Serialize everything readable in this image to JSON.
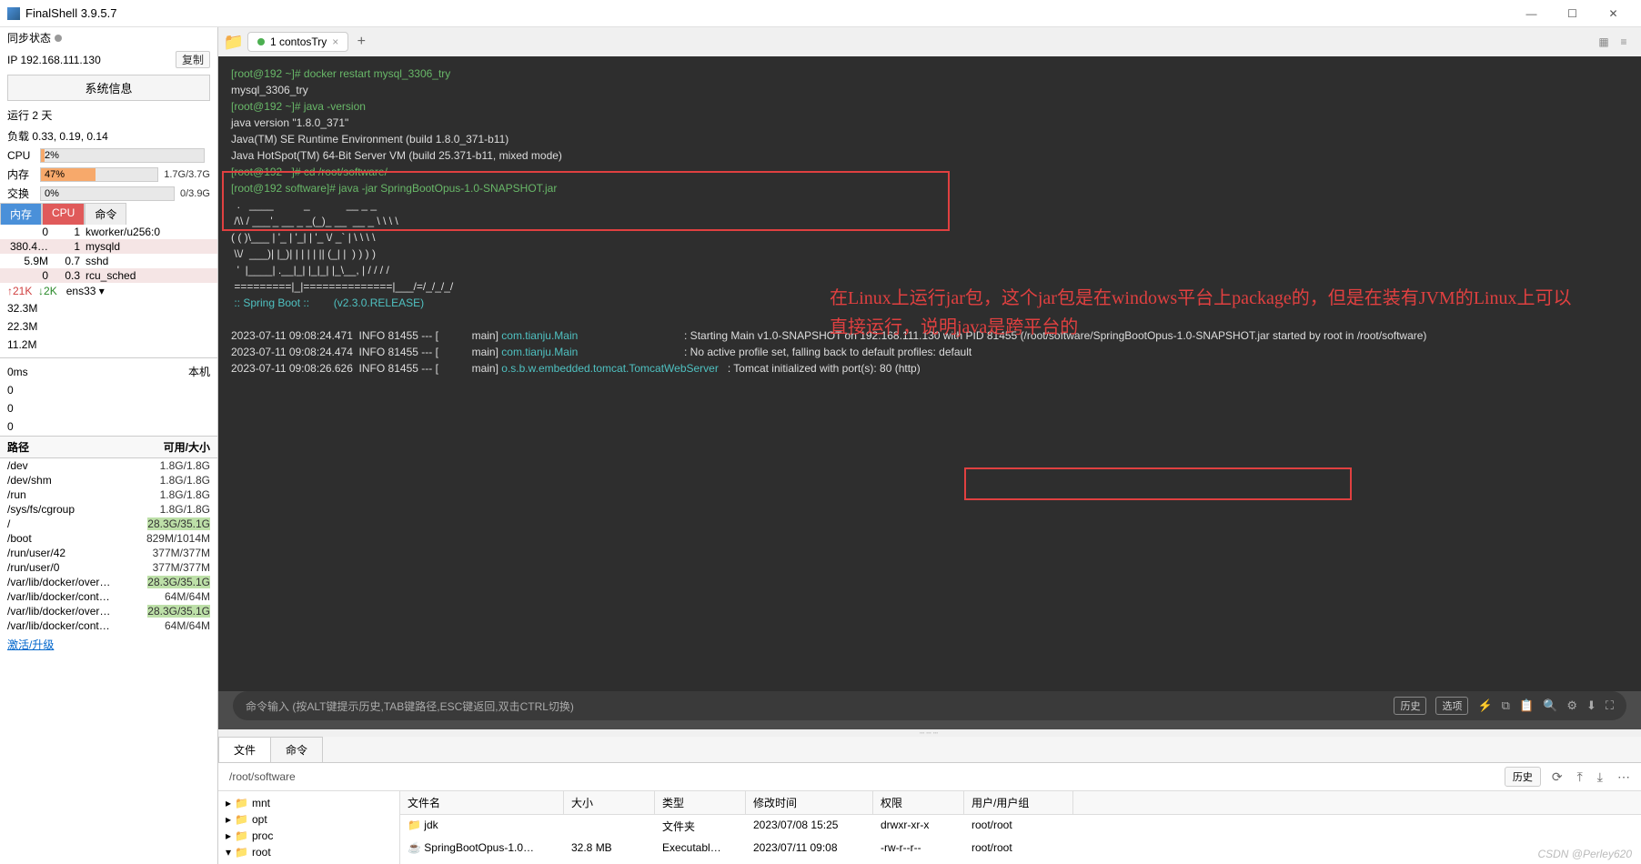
{
  "title": "FinalShell 3.9.5.7",
  "sync_status": "同步状态",
  "ip_label": "IP 192.168.111.130",
  "copy": "复制",
  "sysinfo_btn": "系统信息",
  "run_label": "运行 2 天",
  "load_label": "负载 0.33, 0.19, 0.14",
  "cpu": {
    "label": "CPU",
    "pct": "2%",
    "width": "2%"
  },
  "mem": {
    "label": "内存",
    "pct": "47%",
    "width": "47%",
    "val": "1.7G/3.7G"
  },
  "swap": {
    "label": "交换",
    "pct": "0%",
    "width": "0%",
    "val": "0/3.9G"
  },
  "proc_tabs": {
    "mem": "内存",
    "cpu": "CPU",
    "cmd": "命令"
  },
  "procs": [
    {
      "c1": "0",
      "c2": "1",
      "c3": "kworker/u256:0"
    },
    {
      "c1": "380.4…",
      "c2": "1",
      "c3": "mysqld"
    },
    {
      "c1": "5.9M",
      "c2": "0.7",
      "c3": "sshd"
    },
    {
      "c1": "0",
      "c2": "0.3",
      "c3": "rcu_sched"
    }
  ],
  "net": {
    "up": "↑21K",
    "dn": "↓2K",
    "iface": "ens33 ▾"
  },
  "netvals": [
    "32.3M",
    "22.3M",
    "11.2M"
  ],
  "lat": {
    "ms": "0ms",
    "host": "本机",
    "v": [
      "0",
      "0",
      "0"
    ]
  },
  "path_hdr": {
    "h1": "路径",
    "h2": "可用/大小"
  },
  "paths": [
    {
      "p": "/dev",
      "v": "1.8G/1.8G"
    },
    {
      "p": "/dev/shm",
      "v": "1.8G/1.8G"
    },
    {
      "p": "/run",
      "v": "1.8G/1.8G"
    },
    {
      "p": "/sys/fs/cgroup",
      "v": "1.8G/1.8G"
    },
    {
      "p": "/",
      "v": "28.3G/35.1G",
      "hi": true
    },
    {
      "p": "/boot",
      "v": "829M/1014M"
    },
    {
      "p": "/run/user/42",
      "v": "377M/377M"
    },
    {
      "p": "/run/user/0",
      "v": "377M/377M"
    },
    {
      "p": "/var/lib/docker/over…",
      "v": "28.3G/35.1G",
      "hi": true
    },
    {
      "p": "/var/lib/docker/cont…",
      "v": "64M/64M"
    },
    {
      "p": "/var/lib/docker/over…",
      "v": "28.3G/35.1G",
      "hi": true
    },
    {
      "p": "/var/lib/docker/cont…",
      "v": "64M/64M"
    }
  ],
  "activate": "激活/升级",
  "session_tab": "1 contosTry",
  "terminal_lines": [
    {
      "t": "[root@192 ~]# docker restart mysql_3306_try",
      "c": "prm"
    },
    {
      "t": "mysql_3306_try",
      "c": ""
    },
    {
      "t": "[root@192 ~]# java -version",
      "c": "prm"
    },
    {
      "t": "java version \"1.8.0_371\"",
      "c": ""
    },
    {
      "t": "Java(TM) SE Runtime Environment (build 1.8.0_371-b11)",
      "c": ""
    },
    {
      "t": "Java HotSpot(TM) 64-Bit Server VM (build 25.371-b11, mixed mode)",
      "c": ""
    },
    {
      "t": "[root@192 ~]# cd /root/software/",
      "c": "prm"
    },
    {
      "t": "[root@192 software]# java -jar SpringBootOpus-1.0-SNAPSHOT.jar",
      "c": "prm"
    },
    {
      "t": "",
      "c": ""
    },
    {
      "t": "  .   ____          _            __ _ _",
      "c": ""
    },
    {
      "t": " /\\\\ / ___'_ __ _ _(_)_ __  __ _ \\ \\ \\ \\",
      "c": ""
    },
    {
      "t": "( ( )\\___ | '_ | '_| | '_ \\/ _` | \\ \\ \\ \\",
      "c": ""
    },
    {
      "t": " \\\\/  ___)| |_)| | | | | || (_| |  ) ) ) )",
      "c": ""
    },
    {
      "t": "  '  |____| .__|_| |_|_| |_\\__, | / / / /",
      "c": ""
    },
    {
      "t": " =========|_|==============|___/=/_/_/_/",
      "c": ""
    }
  ],
  "spring_line": " :: Spring Boot ::        (v2.3.0.RELEASE)",
  "annotation": "在Linux上运行jar包，这个jar包是在windows平台上package的，但是在装有JVM的Linux上可以直接运行，说明java是跨平台的",
  "log1a": "2023-07-11 09:08:24.471  INFO 81455 --- [           main] ",
  "log1b": "com.tianju.Main",
  "log1c": "                                   : Starting Main v1.0-SNAPSHOT on 192.168.111.130 with PID 81455 (/root/software/SpringBootOpus-1.0-SNAPSHOT.jar started by root in /root/software)",
  "log2a": "2023-07-11 09:08:24.474  INFO 81455 --- [           main] ",
  "log2b": "com.tianju.Main",
  "log2c": "                                   : No active profile set, falling back to default profiles: default",
  "log3a": "2023-07-11 09:08:26.626  INFO 81455 --- [           main] ",
  "log3b": "o.s.b.w.embedded.tomcat.TomcatWebServer",
  "log3c": "   : Tomcat initialized with port(s): 80 (http)",
  "cmd_placeholder": "命令输入 (按ALT键提示历史,TAB键路径,ESC键返回,双击CTRL切换)",
  "cmd_history": "历史",
  "cmd_opts": "选项",
  "btab_file": "文件",
  "btab_cmd": "命令",
  "breadcrumb": "/root/software",
  "fl_hdr": {
    "name": "文件名",
    "size": "大小",
    "type": "类型",
    "date": "修改时间",
    "perm": "权限",
    "owner": "用户/用户组"
  },
  "tree_items": [
    "mnt",
    "opt",
    "proc",
    "root"
  ],
  "files": [
    {
      "name": "jdk",
      "size": "",
      "type": "文件夹",
      "date": "2023/07/08 15:25",
      "perm": "drwxr-xr-x",
      "owner": "root/root",
      "icon": "folder"
    },
    {
      "name": "SpringBootOpus-1.0…",
      "size": "32.8 MB",
      "type": "Executabl…",
      "date": "2023/07/11 09:08",
      "perm": "-rw-r--r--",
      "owner": "root/root",
      "icon": "jar"
    }
  ],
  "watermark": "CSDN @Perley620"
}
